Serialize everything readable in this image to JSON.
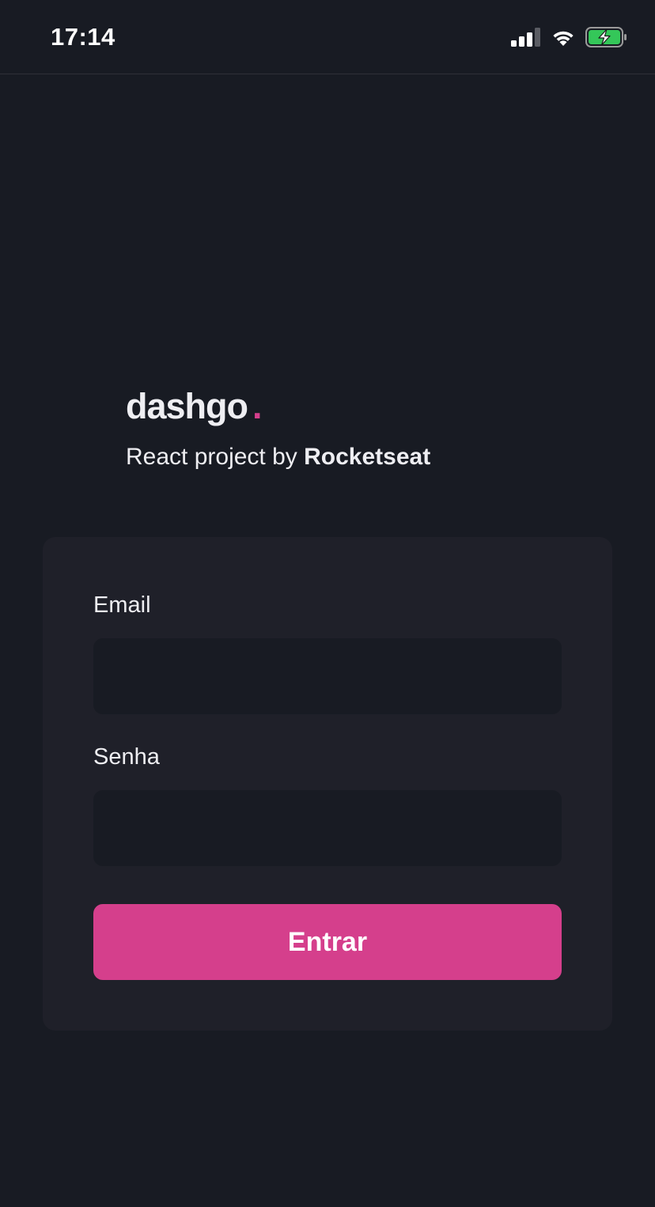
{
  "status_bar": {
    "time": "17:14"
  },
  "brand": {
    "logo_text": "dashgo",
    "logo_dot": ".",
    "tagline_prefix": "React project by ",
    "tagline_strong": "Rocketseat"
  },
  "form": {
    "email_label": "Email",
    "email_value": "",
    "password_label": "Senha",
    "password_value": "",
    "submit_label": "Entrar"
  },
  "colors": {
    "background": "#181b23",
    "card": "#1f2029",
    "accent": "#d53f8c",
    "battery": "#34c759",
    "text": "#eeeef2"
  },
  "icons": [
    "cellular-signal-icon",
    "wifi-icon",
    "battery-charging-icon"
  ]
}
